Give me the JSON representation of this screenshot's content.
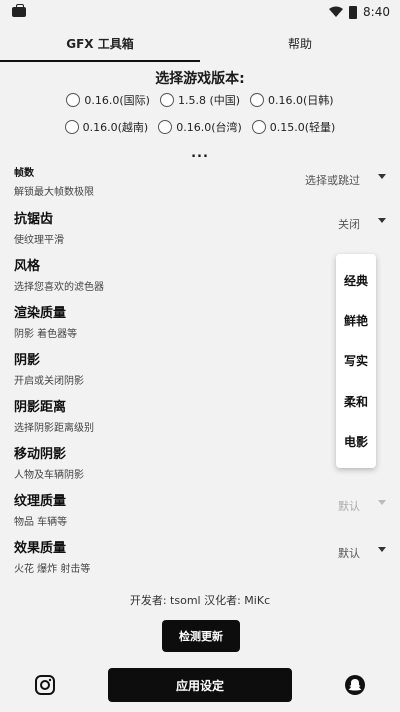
{
  "status_bar": {
    "time": "8:40",
    "icons": [
      "notification-icon",
      "wifi-icon",
      "battery-icon"
    ]
  },
  "tabs": [
    {
      "label": "GFX 工具箱",
      "active": true
    },
    {
      "label": "帮助",
      "active": false
    }
  ],
  "version_section": {
    "title": "选择游戏版本:",
    "options": [
      {
        "label": "0.16.0(国际)"
      },
      {
        "label": "1.5.8 (中国)"
      },
      {
        "label": "0.16.0(日韩)"
      },
      {
        "label": "0.16.0(越南)"
      },
      {
        "label": "0.16.0(台湾)"
      },
      {
        "label": "0.15.0(轻量)"
      }
    ],
    "more": "..."
  },
  "settings": [
    {
      "title": "帧数",
      "desc": "解锁最大帧数极限",
      "value": "选择或跳过",
      "dim": false
    },
    {
      "title": "抗锯齿",
      "desc": "使纹理平滑",
      "value": "关闭",
      "dim": false
    },
    {
      "title": "风格",
      "desc": "选择您喜欢的滤色器",
      "value": "",
      "dim": false
    },
    {
      "title": "渲染质量",
      "desc": "阴影 着色器等",
      "value": "",
      "dim": false
    },
    {
      "title": "阴影",
      "desc": "开启或关闭阴影",
      "value": "",
      "dim": false
    },
    {
      "title": "阴影距离",
      "desc": "选择阴影距离级别",
      "value": "",
      "dim": false
    },
    {
      "title": "移动阴影",
      "desc": "人物及车辆阴影",
      "value": "",
      "dim": false
    },
    {
      "title": "纹理质量",
      "desc": "物品 车辆等",
      "value": "默认",
      "dim": true
    },
    {
      "title": "效果质量",
      "desc": "火花 爆炸 射击等",
      "value": "默认",
      "dim": false
    }
  ],
  "style_dropdown": {
    "items": [
      "经典",
      "鲜艳",
      "写实",
      "柔和",
      "电影"
    ]
  },
  "credits": "开发者: tsoml   汉化者: MiKc",
  "check_update_label": "检测更新",
  "apply_label": "应用设定",
  "footer_icons": [
    "instagram-icon",
    "snapchat-icon"
  ],
  "colors": {
    "accent": "#0d0d0d",
    "background": "#f2f2f2"
  }
}
